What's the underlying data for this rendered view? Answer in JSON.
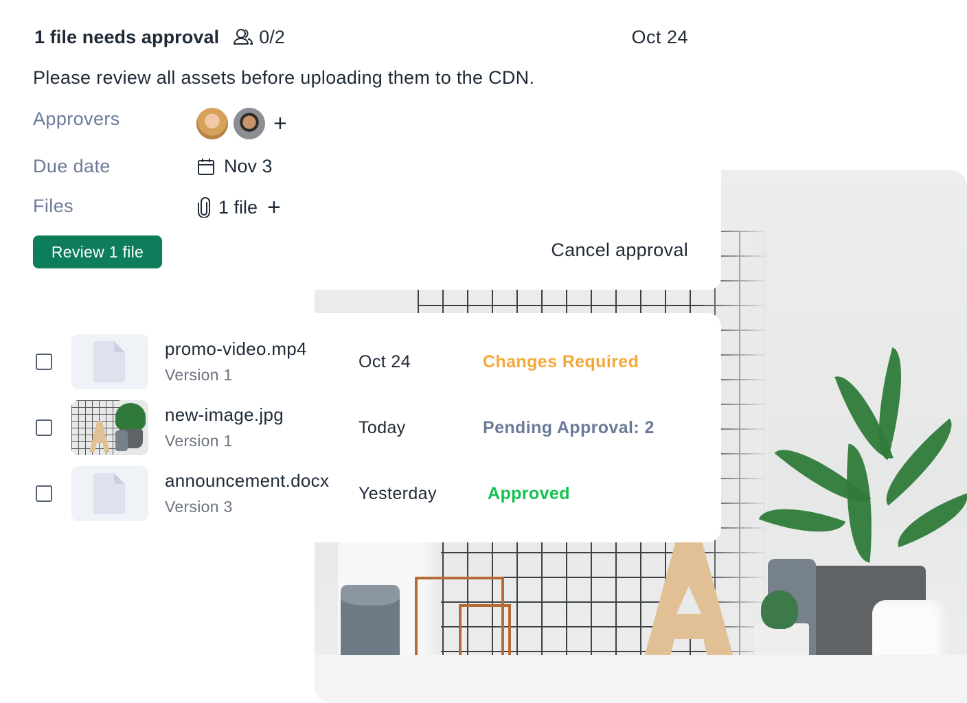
{
  "header": {
    "title": "1 file needs approval",
    "approver_count": "0/2",
    "date": "Oct 24"
  },
  "description": "Please review all assets before uploading them to the CDN.",
  "fields": {
    "approvers_label": "Approvers",
    "due_date_label": "Due date",
    "due_date_value": "Nov 3",
    "files_label": "Files",
    "files_value": "1 file"
  },
  "actions": {
    "review_label": "Review 1 file",
    "cancel_label": "Cancel approval"
  },
  "files": [
    {
      "name": "promo-video.mp4",
      "version": "Version 1",
      "date": "Oct 24",
      "status": "Changes Required",
      "status_color": "#f5a83a",
      "thumbnail": "document-icon"
    },
    {
      "name": "new-image.jpg",
      "version": "Version 1",
      "date": "Today",
      "status": "Pending Approval: 2",
      "status_color": "#6b7a99",
      "thumbnail": "photo-thumbnail"
    },
    {
      "name": "announcement.docx",
      "version": "Version 3",
      "date": "Yesterday",
      "status": "Approved",
      "status_color": "#12c24e",
      "thumbnail": "document-icon"
    }
  ],
  "colors": {
    "primary": "#0e7d5b",
    "label": "#6b7a99",
    "text": "#1f2a37"
  }
}
